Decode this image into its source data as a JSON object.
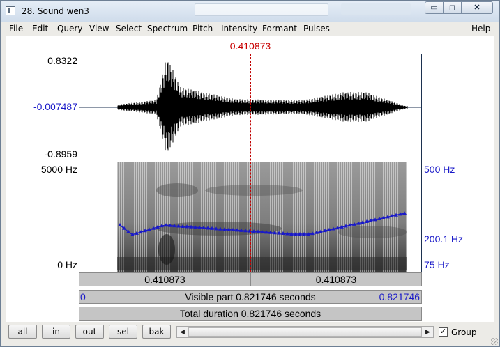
{
  "window": {
    "title": "28. Sound wen3",
    "controls": {
      "minimize": "▭",
      "maximize": "◻",
      "close": "✕"
    }
  },
  "menu": {
    "left": [
      "File",
      "Edit",
      "Query",
      "View",
      "Select",
      "Spectrum",
      "Pitch",
      "Intensity",
      "Formant",
      "Pulses"
    ],
    "right": "Help"
  },
  "editor": {
    "cursor_time": "0.410873",
    "waveform": {
      "max_label": "0.8322",
      "zero_label": "-0.007487",
      "min_label": "-0.8959"
    },
    "spectrogram": {
      "top_freq": "5000 Hz",
      "bottom_freq": "0 Hz"
    },
    "pitch": {
      "top_label": "500 Hz",
      "mid_label": "200.1 Hz",
      "bottom_label": "75 Hz",
      "color": "#1a1ac8"
    },
    "selection_bar": {
      "left": "0.410873",
      "right": "0.410873"
    },
    "visible_bar": {
      "start": "0",
      "text": "Visible part 0.821746 seconds",
      "end": "0.821746"
    },
    "total_bar": {
      "text": "Total duration 0.821746 seconds"
    }
  },
  "bottom": {
    "buttons": [
      "all",
      "in",
      "out",
      "sel",
      "bak"
    ],
    "group_label": "Group",
    "group_checked": "✓"
  }
}
